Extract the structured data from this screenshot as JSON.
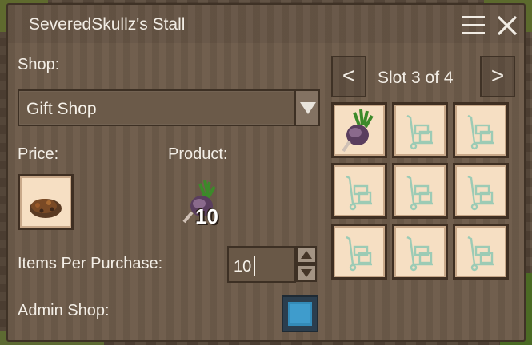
{
  "window": {
    "title": "SeveredSkullz's Stall"
  },
  "shop": {
    "label": "Shop:",
    "selected": "Gift Shop",
    "price_label": "Price:",
    "product_label": "Product:",
    "product_quantity": "10",
    "items_per_purchase_label": "Items Per Purchase:",
    "items_per_purchase_value": "10",
    "admin_shop_label": "Admin Shop:",
    "admin_shop_checked": true
  },
  "pager": {
    "prev": "<",
    "next": ">",
    "label": "Slot 3 of 4"
  },
  "slots": [
    {
      "icon": "turnip-icon"
    },
    {
      "icon": "cart-icon"
    },
    {
      "icon": "cart-icon"
    },
    {
      "icon": "cart-icon"
    },
    {
      "icon": "cart-icon"
    },
    {
      "icon": "cart-icon"
    },
    {
      "icon": "cart-icon"
    },
    {
      "icon": "cart-icon"
    },
    {
      "icon": "cart-icon"
    }
  ],
  "colors": {
    "panel": "#6e5c4b",
    "slot_bg": "#f6dfc3",
    "cart_icon": "#9ccbb5",
    "checkbox_on": "#3f9ccc"
  }
}
